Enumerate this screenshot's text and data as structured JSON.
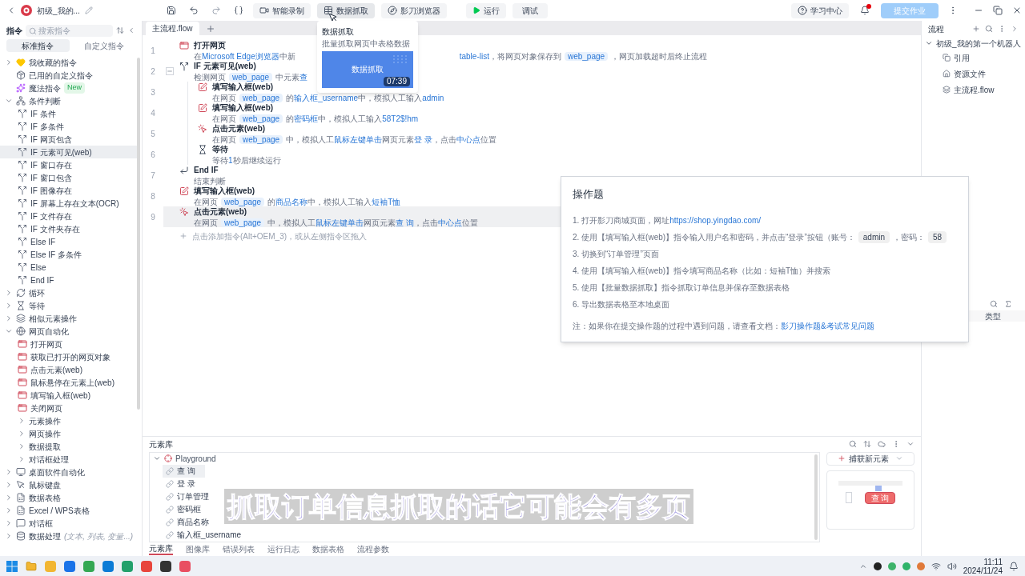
{
  "topbar": {
    "title": "初级_我的...",
    "tools": [
      {
        "label": "智能录制",
        "selected": false
      },
      {
        "label": "数据抓取",
        "selected": true
      },
      {
        "label": "影刀浏览器",
        "selected": false
      }
    ],
    "run": "运行",
    "debug": "调试",
    "learn": "学习中心",
    "notification": true,
    "submit": "提交作业"
  },
  "popup": {
    "title": "数据抓取",
    "subtitle": "批量抓取网页中表格数据",
    "thumb_title": "数据抓取",
    "duration": "07:39"
  },
  "sidebar": {
    "title": "指令",
    "search": {
      "placeholder": "搜索指令"
    },
    "tabs": [
      {
        "label": "标准指令",
        "selected": true
      },
      {
        "label": "自定义指令",
        "selected": false
      }
    ],
    "items": [
      {
        "label": "我收藏的指令",
        "kind": "group",
        "expanded": false,
        "selected": false
      },
      {
        "label": "已用的自定义指令",
        "kind": "command",
        "selected": false
      },
      {
        "label": "魔法指令",
        "kind": "command",
        "selected": false,
        "badge": "New"
      },
      {
        "label": "条件判断",
        "kind": "group",
        "expanded": true,
        "selected": false,
        "children": [
          {
            "label": "IF 条件",
            "kind": "command",
            "selected": false
          },
          {
            "label": "IF 多条件",
            "kind": "command",
            "selected": false
          },
          {
            "label": "IF 网页包含",
            "kind": "command",
            "selected": false
          },
          {
            "label": "IF 元素可见(web)",
            "kind": "command",
            "selected": true
          },
          {
            "label": "IF 窗口存在",
            "kind": "command",
            "selected": false
          },
          {
            "label": "IF 窗口包含",
            "kind": "command",
            "selected": false
          },
          {
            "label": "IF 图像存在",
            "kind": "command",
            "selected": false
          },
          {
            "label": "IF 屏幕上存在文本(OCR)",
            "kind": "command",
            "selected": false
          },
          {
            "label": "IF 文件存在",
            "kind": "command",
            "selected": false
          },
          {
            "label": "IF 文件夹存在",
            "kind": "command",
            "selected": false
          },
          {
            "label": "Else IF",
            "kind": "command",
            "selected": false
          },
          {
            "label": "Else IF 多条件",
            "kind": "command",
            "selected": false
          },
          {
            "label": "Else",
            "kind": "command",
            "selected": false
          },
          {
            "label": "End IF",
            "kind": "command",
            "selected": false
          }
        ]
      },
      {
        "label": "循环",
        "kind": "group",
        "expanded": false,
        "selected": false
      },
      {
        "label": "等待",
        "kind": "group",
        "expanded": false,
        "selected": false
      },
      {
        "label": "相似元素操作",
        "kind": "group",
        "expanded": false,
        "selected": false
      },
      {
        "label": "网页自动化",
        "kind": "group",
        "expanded": true,
        "selected": false,
        "children": [
          {
            "label": "打开网页",
            "kind": "command",
            "selected": false
          },
          {
            "label": "获取已打开的网页对象",
            "kind": "command",
            "selected": false
          },
          {
            "label": "点击元素(web)",
            "kind": "command",
            "selected": false
          },
          {
            "label": "鼠标悬停在元素上(web)",
            "kind": "command",
            "selected": false
          },
          {
            "label": "填写输入框(web)",
            "kind": "command",
            "selected": false
          },
          {
            "label": "关闭网页",
            "kind": "command",
            "selected": false
          },
          {
            "label": "元素操作",
            "kind": "group",
            "expanded": false,
            "selected": false
          },
          {
            "label": "网页操作",
            "kind": "group",
            "expanded": false,
            "selected": false
          },
          {
            "label": "数据提取",
            "kind": "group",
            "expanded": false,
            "selected": false
          },
          {
            "label": "对话框处理",
            "kind": "group",
            "expanded": false,
            "selected": false
          }
        ]
      },
      {
        "label": "桌面软件自动化",
        "kind": "group",
        "expanded": false,
        "selected": false
      },
      {
        "label": "鼠标键盘",
        "kind": "group",
        "expanded": false,
        "selected": false
      },
      {
        "label": "数据表格",
        "kind": "group",
        "expanded": false,
        "selected": false
      },
      {
        "label": "Excel / WPS表格",
        "kind": "group",
        "expanded": false,
        "selected": false
      },
      {
        "label": "对话框",
        "kind": "group",
        "expanded": false,
        "selected": false
      },
      {
        "label": "数据处理",
        "kind": "group",
        "expanded": false,
        "selected": false,
        "hint": "(文本, 列表, 变量...)"
      }
    ]
  },
  "editor": {
    "tabs": [
      {
        "label": "主流程.flow",
        "selected": true
      }
    ],
    "steps": [
      {
        "line": "1",
        "kind": "open",
        "title": "打开网页",
        "selected": false,
        "desc": [
          {
            "kind": "text",
            "text": "在"
          },
          {
            "kind": "link",
            "text": "Microsoft Edge浏览器"
          },
          {
            "kind": "text",
            "text": "中新"
          },
          {
            "kind": "covered"
          },
          {
            "kind": "link",
            "text": "table-list"
          },
          {
            "kind": "text",
            "text": "，将网页对象保存到"
          },
          {
            "kind": "var",
            "text": "web_page"
          },
          {
            "kind": "text",
            "text": "，网页加载超时后终止流程"
          }
        ]
      },
      {
        "line": "2",
        "kind": "if",
        "title": "IF 元素可见(web)",
        "selected": false,
        "expanded": true,
        "desc": [
          {
            "kind": "text",
            "text": "检测网页"
          },
          {
            "kind": "var",
            "text": "web_page"
          },
          {
            "kind": "text",
            "text": "中元素"
          },
          {
            "kind": "link",
            "text": "查"
          }
        ],
        "children": [
          {
            "line": "3",
            "kind": "input",
            "title": "填写输入框(web)",
            "selected": false,
            "desc": [
              {
                "kind": "text",
                "text": "在网页"
              },
              {
                "kind": "var",
                "text": "web_page"
              },
              {
                "kind": "text",
                "text": "的"
              },
              {
                "kind": "link",
                "text": "输入框_username"
              },
              {
                "kind": "text",
                "text": "中，模拟人工输入"
              },
              {
                "kind": "link",
                "text": "admin"
              }
            ]
          },
          {
            "line": "4",
            "kind": "input",
            "title": "填写输入框(web)",
            "selected": false,
            "desc": [
              {
                "kind": "text",
                "text": "在网页"
              },
              {
                "kind": "var",
                "text": "web_page"
              },
              {
                "kind": "text",
                "text": "的"
              },
              {
                "kind": "link",
                "text": "密码框"
              },
              {
                "kind": "text",
                "text": "中，模拟人工输入"
              },
              {
                "kind": "link",
                "text": "58T2$!hm"
              }
            ]
          },
          {
            "line": "5",
            "kind": "click",
            "title": "点击元素(web)",
            "selected": false,
            "desc": [
              {
                "kind": "text",
                "text": "在网页"
              },
              {
                "kind": "var",
                "text": "web_page"
              },
              {
                "kind": "text",
                "text": "中，模拟人工"
              },
              {
                "kind": "link",
                "text": "鼠标左键单击"
              },
              {
                "kind": "text",
                "text": "网页元素"
              },
              {
                "kind": "link",
                "text": "登 录"
              },
              {
                "kind": "text",
                "text": "，点击"
              },
              {
                "kind": "link",
                "text": "中心点"
              },
              {
                "kind": "text",
                "text": "位置"
              }
            ]
          },
          {
            "line": "6",
            "kind": "wait",
            "title": "等待",
            "selected": false,
            "desc": [
              {
                "kind": "text",
                "text": "等待"
              },
              {
                "kind": "link",
                "text": "1"
              },
              {
                "kind": "text",
                "text": "秒后继续运行"
              }
            ]
          }
        ]
      },
      {
        "line": "7",
        "kind": "endif",
        "title": "End IF",
        "selected": false,
        "desc": [
          {
            "kind": "text",
            "text": "结束判断"
          }
        ]
      },
      {
        "line": "8",
        "kind": "input",
        "title": "填写输入框(web)",
        "selected": false,
        "desc": [
          {
            "kind": "text",
            "text": "在网页"
          },
          {
            "kind": "var",
            "text": "web_page"
          },
          {
            "kind": "text",
            "text": "的"
          },
          {
            "kind": "link",
            "text": "商品名称"
          },
          {
            "kind": "text",
            "text": "中，模拟人工输入"
          },
          {
            "kind": "link",
            "text": "短袖T恤"
          }
        ]
      },
      {
        "line": "9",
        "kind": "click",
        "title": "点击元素(web)",
        "selected": true,
        "desc": [
          {
            "kind": "text",
            "text": "在网页"
          },
          {
            "kind": "var",
            "text": "web_page"
          },
          {
            "kind": "text",
            "text": "中，模拟人工"
          },
          {
            "kind": "link",
            "text": "鼠标左键单击"
          },
          {
            "kind": "text",
            "text": "网页元素"
          },
          {
            "kind": "link",
            "text": "查 询"
          },
          {
            "kind": "text",
            "text": "，点击"
          },
          {
            "kind": "link",
            "text": "中心点"
          },
          {
            "kind": "text",
            "text": "位置"
          }
        ]
      }
    ],
    "add_hint": "点击添加指令(Alt+OEM_3)，或从左侧指令区拖入"
  },
  "elements": {
    "title": "元素库",
    "tree": {
      "label": "Playground",
      "expanded": true,
      "children": [
        {
          "label": "查 询",
          "selected": true
        },
        {
          "label": "登 录",
          "selected": false
        },
        {
          "label": "订单管理",
          "selected": false
        },
        {
          "label": "密码框",
          "selected": false
        },
        {
          "label": "商品名称",
          "selected": false
        },
        {
          "label": "输入框_username",
          "selected": false
        }
      ]
    },
    "capture": "捕获新元素",
    "preview_button": "查 询",
    "tabs": [
      {
        "label": "元素库",
        "selected": true
      },
      {
        "label": "图像库",
        "selected": false
      },
      {
        "label": "错误列表",
        "selected": false
      },
      {
        "label": "运行日志",
        "selected": false
      },
      {
        "label": "数据表格",
        "selected": false
      },
      {
        "label": "流程参数",
        "selected": false
      }
    ]
  },
  "flow_panel": {
    "title": "流程",
    "root": {
      "label": "初级_我的第一个机器人",
      "expanded": true,
      "children": [
        {
          "label": "引用",
          "kind": "reference"
        },
        {
          "label": "资源文件",
          "kind": "resource"
        },
        {
          "label": "主流程.flow",
          "kind": "flow"
        }
      ]
    },
    "column": "类型"
  },
  "dialog": {
    "title": "操作题",
    "items": [
      [
        {
          "kind": "text",
          "text": "1. 打开影刀商城页面，网址"
        },
        {
          "kind": "link",
          "text": "https://shop.yingdao.com/"
        }
      ],
      [
        {
          "kind": "text",
          "text": "2. 使用【填写输入框(web)】指令输入用户名和密码，并点击“登录”按钮（账号："
        },
        {
          "kind": "code",
          "text": "admin"
        },
        {
          "kind": "text",
          "text": "，密码："
        },
        {
          "kind": "code",
          "text": "58"
        }
      ],
      [
        {
          "kind": "text",
          "text": "3. 切换到“订单管理”页面"
        }
      ],
      [
        {
          "kind": "text",
          "text": "4. 使用【填写输入框(web)】指令填写商品名称（比如：短袖T恤）并搜索"
        }
      ],
      [
        {
          "kind": "text",
          "text": "5. 使用【批量数据抓取】指令抓取订单信息并保存至数据表格"
        }
      ],
      [
        {
          "kind": "text",
          "text": "6. 导出数据表格至本地桌面"
        }
      ]
    ],
    "note": [
      {
        "kind": "text",
        "text": "注：如果你在提交操作题的过程中遇到问题，请查看文档："
      },
      {
        "kind": "link",
        "text": "影刀操作题&考试常见问题"
      }
    ]
  },
  "subtitle": "抓取订单信息抓取的话它可能会有多页",
  "taskbar": {
    "time": "11:11",
    "date": "2024/11/24"
  }
}
